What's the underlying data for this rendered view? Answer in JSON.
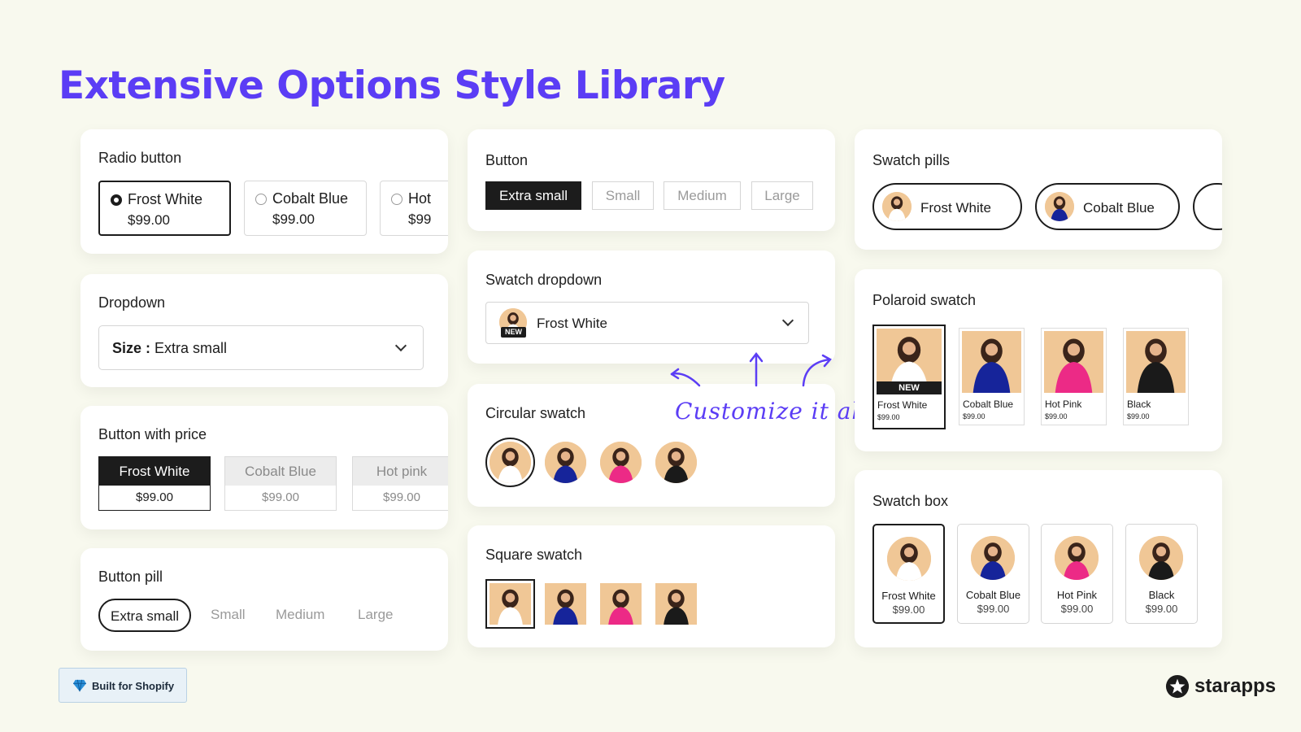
{
  "title": "Extensive Options Style Library",
  "colors": {
    "accent": "#5b3df5",
    "dark": "#1c1c1c",
    "background": "#f8f9ee"
  },
  "radio": {
    "title": "Radio button",
    "options": [
      {
        "name": "Frost White",
        "price": "$99.00"
      },
      {
        "name": "Cobalt Blue",
        "price": "$99.00"
      },
      {
        "name": "Hot",
        "price": "$99"
      }
    ]
  },
  "dropdown": {
    "title": "Dropdown",
    "label": "Size :",
    "value": "Extra small"
  },
  "button_price": {
    "title": "Button with price",
    "options": [
      {
        "name": "Frost White",
        "price": "$99.00"
      },
      {
        "name": "Cobalt Blue",
        "price": "$99.00"
      },
      {
        "name": "Hot pink",
        "price": "$99.00"
      }
    ]
  },
  "button_pill": {
    "title": "Button pill",
    "options": [
      "Extra small",
      "Small",
      "Medium",
      "Large"
    ]
  },
  "button": {
    "title": "Button",
    "options": [
      "Extra small",
      "Small",
      "Medium",
      "Large"
    ]
  },
  "swatch_dropdown": {
    "title": "Swatch dropdown",
    "value": "Frost White",
    "tag": "NEW"
  },
  "circular_swatch": {
    "title": "Circular swatch"
  },
  "square_swatch": {
    "title": "Square swatch"
  },
  "customize": "Customize it all",
  "swatch_pills": {
    "title": "Swatch pills",
    "options": [
      "Frost White",
      "Cobalt Blue"
    ]
  },
  "polaroid": {
    "title": "Polaroid swatch",
    "tag": "NEW",
    "options": [
      {
        "name": "Frost White",
        "price": "$99.00"
      },
      {
        "name": "Cobalt Blue",
        "price": "$99.00"
      },
      {
        "name": "Hot Pink",
        "price": "$99.00"
      },
      {
        "name": "Black",
        "price": "$99.00"
      }
    ]
  },
  "swatch_box": {
    "title": "Swatch box",
    "options": [
      {
        "name": "Frost White",
        "price": "$99.00"
      },
      {
        "name": "Cobalt Blue",
        "price": "$99.00"
      },
      {
        "name": "Hot Pink",
        "price": "$99.00"
      },
      {
        "name": "Black",
        "price": "$99.00"
      }
    ]
  },
  "swatch_colors": [
    "#ffffff",
    "#16249a",
    "#ec2a86",
    "#1a1a1a"
  ],
  "badge": "Built for Shopify",
  "brand": "starapps"
}
